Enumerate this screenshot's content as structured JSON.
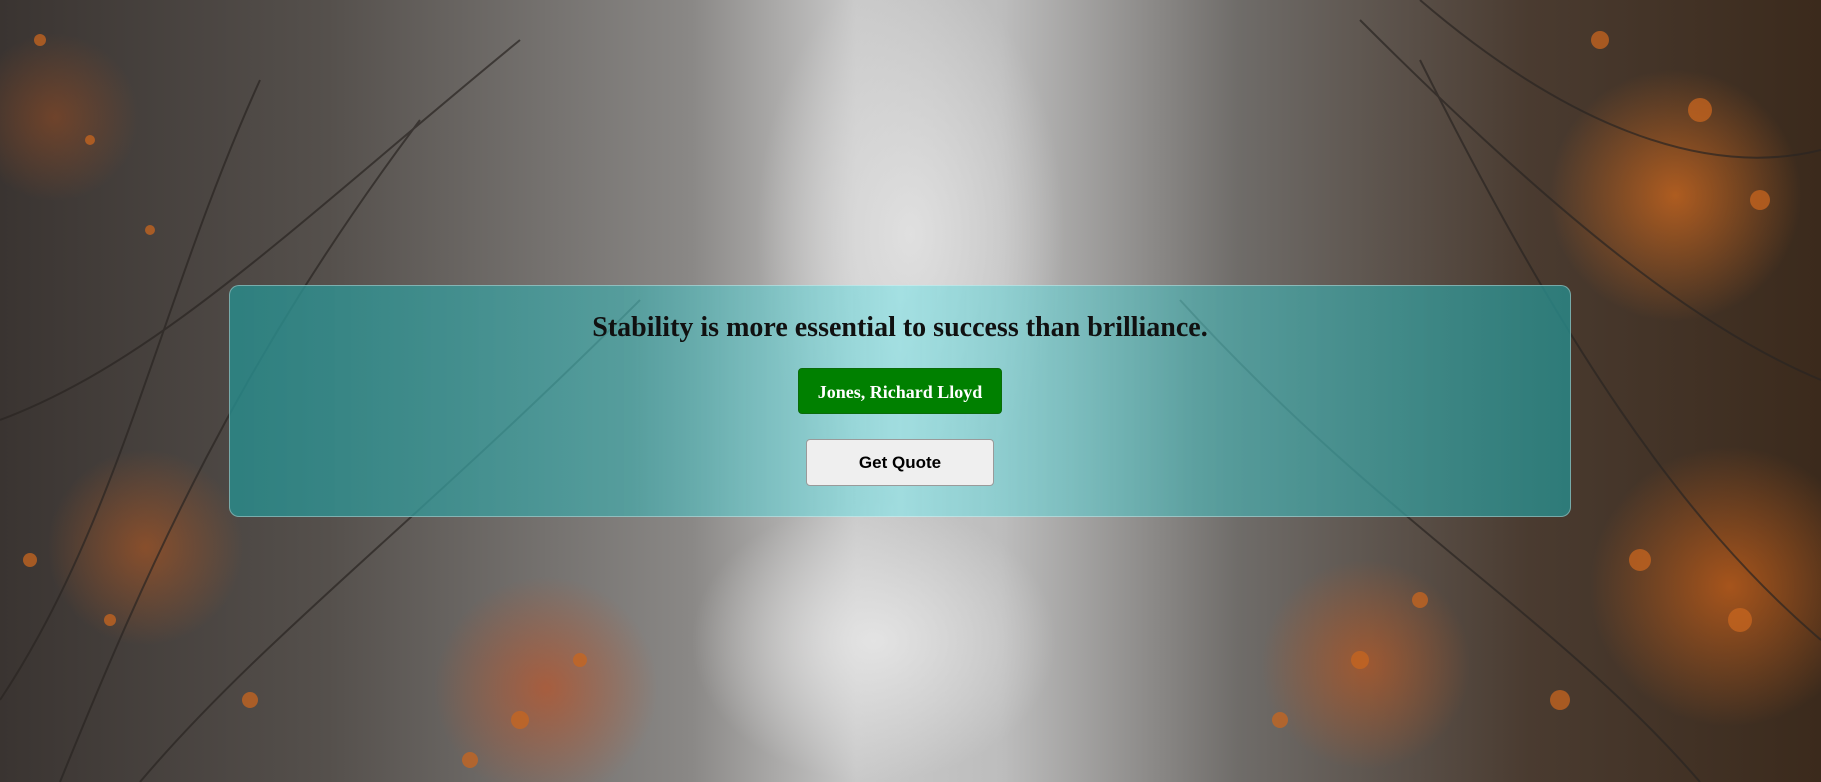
{
  "background": {
    "description_icon": "autumn-forest-photo"
  },
  "quote": {
    "text": "Stability is more essential to success than brilliance.",
    "author": "Jones, Richard Lloyd"
  },
  "actions": {
    "get_quote_label": "Get Quote"
  },
  "colors": {
    "author_button": "#008000",
    "card_tint": "#2e8b8b",
    "get_quote_button": "#efefef"
  }
}
